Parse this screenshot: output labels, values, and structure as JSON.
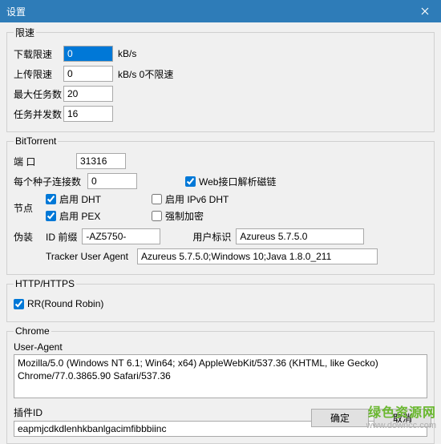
{
  "title": "设置",
  "limits": {
    "legend": "限速",
    "download_label": "下载限速",
    "download_value": "0",
    "upload_label": "上传限速",
    "upload_value": "0",
    "max_tasks_label": "最大任务数",
    "max_tasks_value": "20",
    "concurrent_label": "任务并发数",
    "concurrent_value": "16",
    "unit_kbs": "kB/s",
    "unit_hint": "kB/s   0不限速"
  },
  "bt": {
    "legend": "BitTorrent",
    "port_label": "端 口",
    "port_value": "31316",
    "conn_per_seed_label": "每个种子连接数",
    "conn_per_seed_value": "0",
    "web_magnet_label": "Web接口解析磁链",
    "nodes_label": "节点",
    "enable_dht": "启用 DHT",
    "enable_ipv6_dht": "启用 IPv6 DHT",
    "enable_pex": "启用 PEX",
    "force_encrypt": "强制加密",
    "spoof_label": "伪装",
    "id_prefix_label": "ID 前缀",
    "id_prefix_value": "-AZ5750-",
    "user_ident_label": "用户标识",
    "user_ident_value": "Azureus 5.7.5.0",
    "tracker_ua_label": "Tracker User Agent",
    "tracker_ua_value": "Azureus 5.7.5.0;Windows 10;Java 1.8.0_211"
  },
  "http": {
    "legend": "HTTP/HTTPS",
    "rr_label": "RR(Round Robin)"
  },
  "chrome": {
    "legend": "Chrome",
    "ua_label": "User-Agent",
    "ua_value": "Mozilla/5.0 (Windows NT 6.1; Win64; x64) AppleWebKit/537.36 (KHTML, like Gecko) Chrome/77.0.3865.90 Safari/537.36",
    "plugin_id_label": "插件ID",
    "plugin_id_value": "eapmjcdkdlenhkbanlgacimfibbbiinc"
  },
  "buttons": {
    "ok": "确定",
    "cancel": "取消"
  },
  "watermark": {
    "line1": "绿色资源网",
    "line2": "www.downcc.com"
  }
}
